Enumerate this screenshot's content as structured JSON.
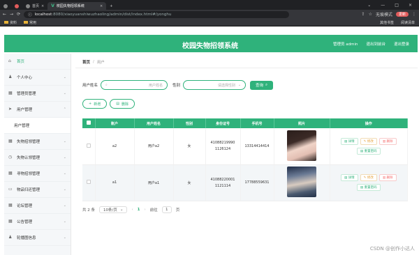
{
  "browser": {
    "tabs": [
      {
        "label": "首页"
      },
      {
        "label": "校园失物招领系统"
      }
    ],
    "url_host": "localhost",
    "url_path": ":8080/xiaoyuanshiwuzhaoling/admin/dist/index.html#/yonghu",
    "profile_label": "无痕模式",
    "update_label": "更新",
    "bookmarks": [
      "资料",
      "常用"
    ],
    "bookmarks_right": [
      "其他书签",
      "阅读清单"
    ]
  },
  "header": {
    "title": "校园失物招领系统",
    "role_label": "管理员 admin",
    "exit_frontend": "退出到前台",
    "logout": "退出登录"
  },
  "sidebar": {
    "items": [
      {
        "label": "首页",
        "icon": "home-icon"
      },
      {
        "label": "个人中心",
        "icon": "user-icon"
      },
      {
        "label": "管理员管理",
        "icon": "grid-icon"
      },
      {
        "label": "用户管理",
        "icon": "send-icon"
      },
      {
        "label": "用户管理",
        "icon": ""
      },
      {
        "label": "失物招领管理",
        "icon": "grid-icon"
      },
      {
        "label": "失物认领管理",
        "icon": "clock-icon"
      },
      {
        "label": "寻物招领管理",
        "icon": "grid-icon"
      },
      {
        "label": "物品归还管理",
        "icon": "doc-icon"
      },
      {
        "label": "论坛管理",
        "icon": "grid-icon"
      },
      {
        "label": "公告管理",
        "icon": "grid-icon"
      },
      {
        "label": "轮播图信息",
        "icon": "user-icon"
      }
    ]
  },
  "breadcrumb": {
    "home": "首页",
    "sep": "/",
    "current": "用户"
  },
  "search": {
    "name_label": "用户姓名",
    "name_placeholder": "用户姓名",
    "gender_label": "性别",
    "gender_placeholder": "请选择性别",
    "button": "查询"
  },
  "actions": {
    "add": "新增",
    "delete": "删除"
  },
  "table": {
    "headers": [
      "账户",
      "用户姓名",
      "性别",
      "身份证号",
      "手机号",
      "照片",
      "操作"
    ],
    "rows": [
      {
        "account": "a2",
        "name": "用户a2",
        "gender": "女",
        "id_line1": "41088219990",
        "id_line2": "1126124",
        "phone": "13314414414"
      },
      {
        "account": "a1",
        "name": "用户a1",
        "gender": "女",
        "id_line1": "41088220001",
        "id_line2": "1121114",
        "phone": "17788559631"
      }
    ],
    "op_detail": "详情",
    "op_edit": "修改",
    "op_delete": "删除",
    "op_reset": "重置密码"
  },
  "pager": {
    "total": "共 2 条",
    "page_size": "10条/页",
    "current": "1",
    "goto_label": "前往",
    "goto_value": "1",
    "page_unit": "页"
  },
  "watermark": "CSDN @创作小达人",
  "colors": {
    "accent": "#2fb27b",
    "edit": "#e6a23c",
    "delete": "#f56c6c"
  }
}
